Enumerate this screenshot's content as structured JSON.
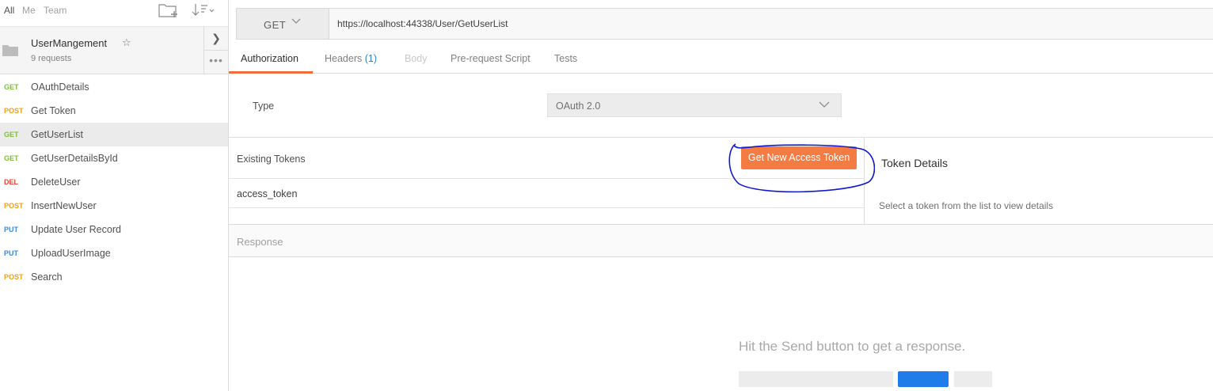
{
  "sidebar": {
    "filters": [
      "All",
      "Me",
      "Team"
    ],
    "collection": {
      "name": "UserMangement",
      "count_label": "9 requests"
    },
    "requests": [
      {
        "method": "GET",
        "name": "OAuthDetails"
      },
      {
        "method": "POST",
        "name": "Get Token"
      },
      {
        "method": "GET",
        "name": "GetUserList"
      },
      {
        "method": "GET",
        "name": "GetUserDetailsById"
      },
      {
        "method": "DEL",
        "name": "DeleteUser"
      },
      {
        "method": "POST",
        "name": "InsertNewUser"
      },
      {
        "method": "PUT",
        "name": "Update User Record"
      },
      {
        "method": "PUT",
        "name": "UploadUserImage"
      },
      {
        "method": "POST",
        "name": "Search"
      }
    ],
    "selected_index": 2,
    "method_colors": {
      "GET": "#7fbd3d",
      "POST": "#f0a019",
      "DEL": "#e0463a",
      "PUT": "#3f8ad2"
    }
  },
  "request": {
    "method": "GET",
    "url": "https://localhost:44338/User/GetUserList"
  },
  "tabs": {
    "authorization": "Authorization",
    "headers": "Headers",
    "headers_count": "(1)",
    "body": "Body",
    "prerequest": "Pre-request Script",
    "tests": "Tests"
  },
  "auth": {
    "type_label": "Type",
    "type_value": "OAuth 2.0",
    "existing_tokens_label": "Existing Tokens",
    "tokens": [
      "access_token"
    ],
    "get_token_button": "Get New Access Token",
    "token_details_title": "Token Details",
    "token_details_hint": "Select a token from the list to view details"
  },
  "response": {
    "label": "Response",
    "empty_hint": "Hit the Send button to get a response."
  },
  "colors": {
    "accent": "#f26b3a",
    "primary_button": "#f47b42",
    "annotation_circle": "#1018d0"
  }
}
